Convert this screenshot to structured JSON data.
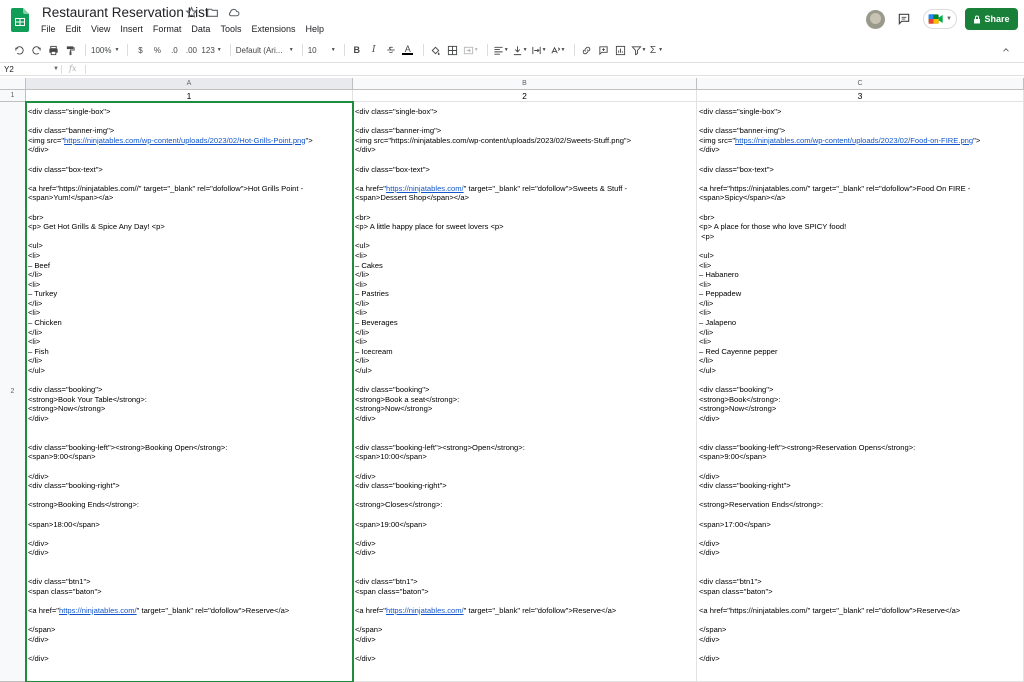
{
  "app": {
    "title": "Restaurant Reservation List",
    "menus": [
      "File",
      "Edit",
      "View",
      "Insert",
      "Format",
      "Data",
      "Tools",
      "Extensions",
      "Help"
    ],
    "share_label": "Share",
    "accent": "#188038"
  },
  "toolbar": {
    "zoom": "100%",
    "currency": "$",
    "percent": "%",
    "dec_less": ".0",
    "dec_more": ".00",
    "more_formats": "123",
    "font": "Default (Ari...",
    "font_size": "10",
    "bold": "B",
    "italic": "I",
    "text_color": "A"
  },
  "formula_bar": {
    "cell_ref": "Y2",
    "fx": "fx",
    "value": ""
  },
  "grid": {
    "columns": [
      "A",
      "B",
      "C"
    ],
    "rows": [
      "1",
      "2"
    ],
    "row1": [
      "1",
      "2",
      "3"
    ],
    "cells": [
      {
        "lines": [
          [
            "<div class=\"single-box\">"
          ],
          [
            ""
          ],
          [
            "<div class=\"banner-img\">"
          ],
          [
            "<img src=\"",
            "https://ninjatables.com/wp-content/uploads/2023/02/Hot-Grills-Point.png",
            "\">"
          ],
          [
            "</div>"
          ],
          [
            ""
          ],
          [
            "<div class=\"box-text\">"
          ],
          [
            ""
          ],
          [
            "<a href=\"https://ninjatables.com//\" target=\"_blank\" rel=\"dofollow\">Hot Grills Point -"
          ],
          [
            "<span>Yum!</span></a>"
          ],
          [
            ""
          ],
          [
            "<br>"
          ],
          [
            "<p> Get Hot Grills & Spice Any Day! <p>"
          ],
          [
            ""
          ],
          [
            "<ul>"
          ],
          [
            "<li>"
          ],
          [
            "– Beef"
          ],
          [
            "</li>"
          ],
          [
            "<li>"
          ],
          [
            "– Turkey"
          ],
          [
            "</li>"
          ],
          [
            "<li>"
          ],
          [
            "– Chicken"
          ],
          [
            "</li>"
          ],
          [
            "<li>"
          ],
          [
            "– Fish"
          ],
          [
            "</li>"
          ],
          [
            "</ul>"
          ],
          [
            ""
          ],
          [
            "<div class=\"booking\">"
          ],
          [
            "<strong>Book Your Table</strong>:"
          ],
          [
            "<strong>Now</strong>"
          ],
          [
            "</div>"
          ],
          [
            ""
          ],
          [
            ""
          ],
          [
            "<div class=\"booking-left\"><strong>Booking Open</strong>:"
          ],
          [
            "<span>9:00</span>"
          ],
          [
            ""
          ],
          [
            "</div>"
          ],
          [
            "<div class=\"booking-right\">"
          ],
          [
            ""
          ],
          [
            "<strong>Booking Ends</strong>:"
          ],
          [
            ""
          ],
          [
            "<span>18:00</span>"
          ],
          [
            ""
          ],
          [
            "</div>"
          ],
          [
            "</div>"
          ],
          [
            ""
          ],
          [
            ""
          ],
          [
            "<div class=\"btn1\">"
          ],
          [
            "<span class=\"baton\">"
          ],
          [
            ""
          ],
          [
            "<a href=\"",
            "https://ninjatables.com/",
            "\" target=\"_blank\" rel=\"dofollow\">Reserve</a>"
          ],
          [
            ""
          ],
          [
            "</span>"
          ],
          [
            "</div>"
          ],
          [
            ""
          ],
          [
            "</div>"
          ]
        ]
      },
      {
        "lines": [
          [
            "<div class=\"single-box\">"
          ],
          [
            ""
          ],
          [
            "<div class=\"banner-img\">"
          ],
          [
            "<img src=\"https://ninjatables.com/wp-content/uploads/2023/02/Sweets-Stuff.png\">"
          ],
          [
            "</div>"
          ],
          [
            ""
          ],
          [
            "<div class=\"box-text\">"
          ],
          [
            ""
          ],
          [
            "<a href=\"",
            "https://ninjatables.com/",
            "\" target=\"_blank\" rel=\"dofollow\">Sweets & Stuff -"
          ],
          [
            "<span>Dessert Shop</span></a>"
          ],
          [
            ""
          ],
          [
            "<br>"
          ],
          [
            "<p> A little happy place for sweet lovers <p>"
          ],
          [
            ""
          ],
          [
            "<ul>"
          ],
          [
            "<li>"
          ],
          [
            "– Cakes"
          ],
          [
            "</li>"
          ],
          [
            "<li>"
          ],
          [
            "– Pastries"
          ],
          [
            "</li>"
          ],
          [
            "<li>"
          ],
          [
            "– Beverages"
          ],
          [
            "</li>"
          ],
          [
            "<li>"
          ],
          [
            "– Icecream"
          ],
          [
            "</li>"
          ],
          [
            "</ul>"
          ],
          [
            ""
          ],
          [
            "<div class=\"booking\">"
          ],
          [
            "<strong>Book a seat</strong>:"
          ],
          [
            "<strong>Now</strong>"
          ],
          [
            "</div>"
          ],
          [
            ""
          ],
          [
            ""
          ],
          [
            "<div class=\"booking-left\"><strong>Open</strong>:"
          ],
          [
            "<span>10:00</span>"
          ],
          [
            ""
          ],
          [
            "</div>"
          ],
          [
            "<div class=\"booking-right\">"
          ],
          [
            ""
          ],
          [
            "<strong>Closes</strong>:"
          ],
          [
            ""
          ],
          [
            "<span>19:00</span>"
          ],
          [
            ""
          ],
          [
            "</div>"
          ],
          [
            "</div>"
          ],
          [
            ""
          ],
          [
            ""
          ],
          [
            "<div class=\"btn1\">"
          ],
          [
            "<span class=\"baton\">"
          ],
          [
            ""
          ],
          [
            "<a href=\"",
            "https://ninjatables.com/",
            "\" target=\"_blank\" rel=\"dofollow\">Reserve</a>"
          ],
          [
            ""
          ],
          [
            "</span>"
          ],
          [
            "</div>"
          ],
          [
            ""
          ],
          [
            "</div>"
          ]
        ]
      },
      {
        "lines": [
          [
            "<div class=\"single-box\">"
          ],
          [
            ""
          ],
          [
            "<div class=\"banner-img\">"
          ],
          [
            "<img src=\"",
            "https://ninjatables.com/wp-content/uploads/2023/02/Food-on-FIRE.png",
            "\">"
          ],
          [
            "</div>"
          ],
          [
            ""
          ],
          [
            "<div class=\"box-text\">"
          ],
          [
            ""
          ],
          [
            "<a href=\"https://ninjatables.com/\" target=\"_blank\" rel=\"dofollow\">Food On FIRE -"
          ],
          [
            "<span>Spicy</span></a>"
          ],
          [
            ""
          ],
          [
            "<br>"
          ],
          [
            "<p> A place for those who love SPICY food!"
          ],
          [
            " <p>"
          ],
          [
            ""
          ],
          [
            "<ul>"
          ],
          [
            "<li>"
          ],
          [
            "– Habanero"
          ],
          [
            "<li>"
          ],
          [
            "– Peppadew"
          ],
          [
            "</li>"
          ],
          [
            "<li>"
          ],
          [
            "– Jalapeno"
          ],
          [
            "</li>"
          ],
          [
            "<li>"
          ],
          [
            "– Red Cayenne pepper"
          ],
          [
            "</li>"
          ],
          [
            "</ul>"
          ],
          [
            ""
          ],
          [
            "<div class=\"booking\">"
          ],
          [
            "<strong>Book</strong>:"
          ],
          [
            "<strong>Now</strong>"
          ],
          [
            "</div>"
          ],
          [
            ""
          ],
          [
            ""
          ],
          [
            "<div class=\"booking-left\"><strong>Reservation Opens</strong>:"
          ],
          [
            "<span>9:00</span>"
          ],
          [
            ""
          ],
          [
            "</div>"
          ],
          [
            "<div class=\"booking-right\">"
          ],
          [
            ""
          ],
          [
            "<strong>Reservation Ends</strong>:"
          ],
          [
            ""
          ],
          [
            "<span>17:00</span>"
          ],
          [
            ""
          ],
          [
            "</div>"
          ],
          [
            "</div>"
          ],
          [
            ""
          ],
          [
            ""
          ],
          [
            "<div class=\"btn1\">"
          ],
          [
            "<span class=\"baton\">"
          ],
          [
            ""
          ],
          [
            "<a href=\"https://ninjatables.com/\" target=\"_blank\" rel=\"dofollow\">Reserve</a>"
          ],
          [
            ""
          ],
          [
            "</span>"
          ],
          [
            "</div>"
          ],
          [
            ""
          ],
          [
            "</div>"
          ]
        ]
      }
    ]
  }
}
